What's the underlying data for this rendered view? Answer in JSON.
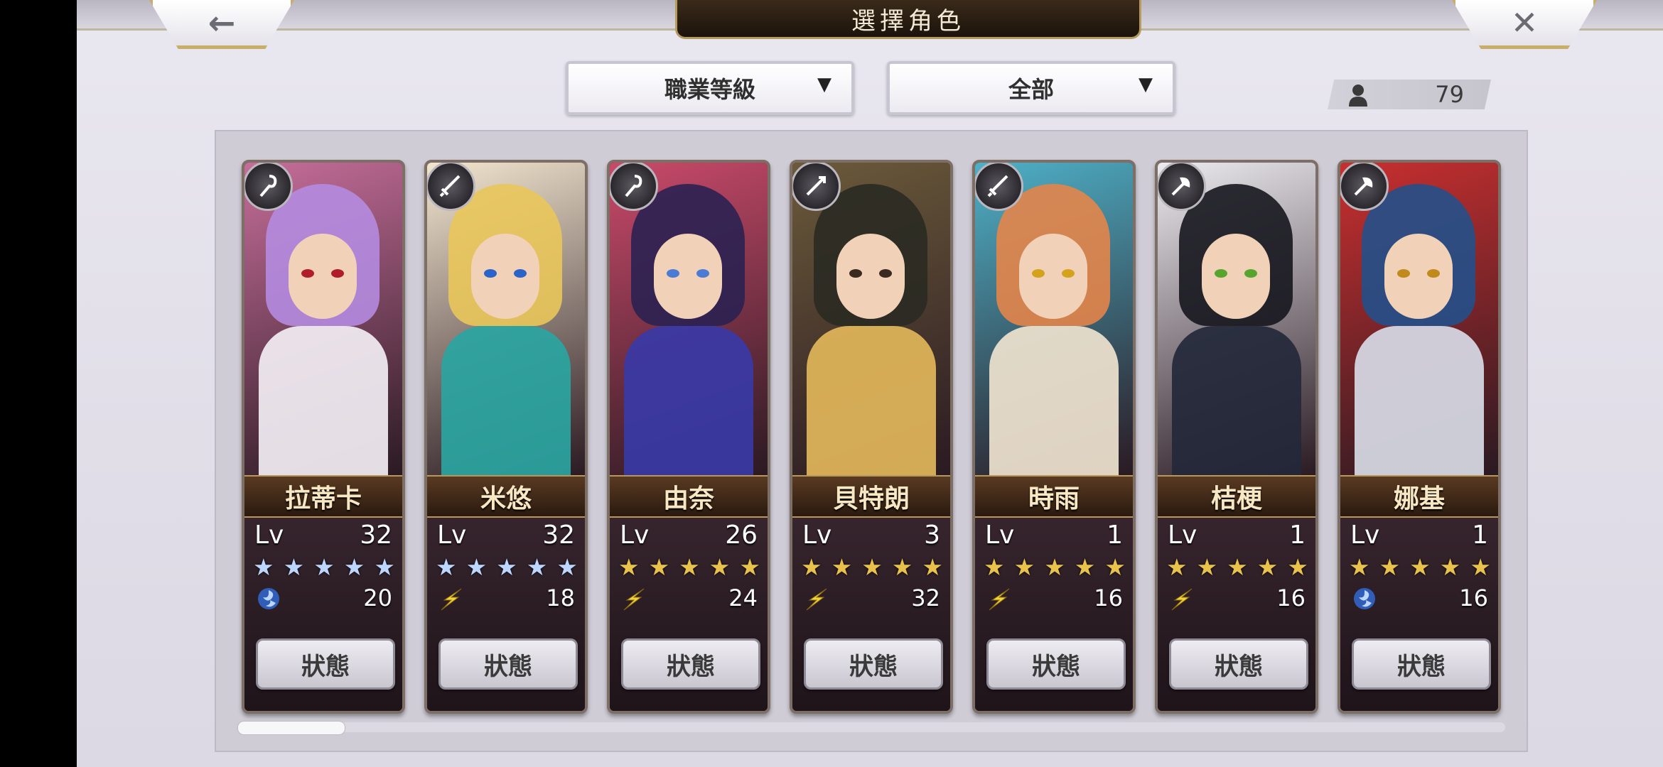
{
  "title": "選擇角色",
  "top_bar": {
    "back_icon": "arrow-left-icon",
    "close_icon": "close-x-icon"
  },
  "filters": {
    "job": {
      "label": "職業等級"
    },
    "category": {
      "label": "全部"
    }
  },
  "character_count": "79",
  "colors": {
    "gold_border": "#c9ae6a",
    "star_blue": "#bcd6ff",
    "star_gold": "#e8c24a"
  },
  "characters": [
    {
      "name": "拉蒂卡",
      "lv_label": "Lv",
      "level": "32",
      "stars": 5,
      "star_type": "blue",
      "stat_icon": "wind-swirl-icon",
      "stat": "20",
      "status_label": "狀態",
      "class_icon": "staff-icon",
      "hair": "#b58be0",
      "outfit": "#f3eef4",
      "bg": "#c66e9a",
      "eye": "#b01c2a"
    },
    {
      "name": "米悠",
      "lv_label": "Lv",
      "level": "32",
      "stars": 5,
      "star_type": "blue",
      "stat_icon": "lightning-wing-icon",
      "stat": "18",
      "status_label": "狀態",
      "class_icon": "sword-icon",
      "hair": "#e9c65a",
      "outfit": "#2aa5a2",
      "bg": "#f2e6cf",
      "eye": "#2a63c9"
    },
    {
      "name": "由奈",
      "lv_label": "Lv",
      "level": "26",
      "stars": 5,
      "star_type": "gold",
      "stat_icon": "lightning-wing-icon",
      "stat": "24",
      "status_label": "狀態",
      "class_icon": "staff-icon",
      "hair": "#2b2152",
      "outfit": "#3a3aa6",
      "bg": "#c94a6a",
      "eye": "#4c7bd6"
    },
    {
      "name": "貝特朗",
      "lv_label": "Lv",
      "level": "3",
      "stars": 5,
      "star_type": "gold",
      "stat_icon": "lightning-wing-icon",
      "stat": "32",
      "status_label": "狀態",
      "class_icon": "spear-icon",
      "hair": "#2a2a22",
      "outfit": "#e2b65a",
      "bg": "#6b5a3a",
      "eye": "#3a2a20"
    },
    {
      "name": "時雨",
      "lv_label": "Lv",
      "level": "1",
      "stars": 5,
      "star_type": "gold",
      "stat_icon": "lightning-wing-icon",
      "stat": "16",
      "status_label": "狀態",
      "class_icon": "sword-icon",
      "hair": "#e3854a",
      "outfit": "#efe3cf",
      "bg": "#4eb0c7",
      "eye": "#d4a21c"
    },
    {
      "name": "桔梗",
      "lv_label": "Lv",
      "level": "1",
      "stars": 5,
      "star_type": "gold",
      "stat_icon": "lightning-wing-icon",
      "stat": "16",
      "status_label": "狀態",
      "class_icon": "axe-icon",
      "hair": "#16161e",
      "outfit": "#23283a",
      "bg": "#ecebef",
      "eye": "#58a52e"
    },
    {
      "name": "娜基",
      "lv_label": "Lv",
      "level": "1",
      "stars": 5,
      "star_type": "gold",
      "stat_icon": "wind-swirl-icon",
      "stat": "16",
      "status_label": "狀態",
      "class_icon": "axe-icon",
      "hair": "#23508a",
      "outfit": "#d8dbe6",
      "bg": "#c82f2f",
      "eye": "#c08a1c"
    }
  ]
}
